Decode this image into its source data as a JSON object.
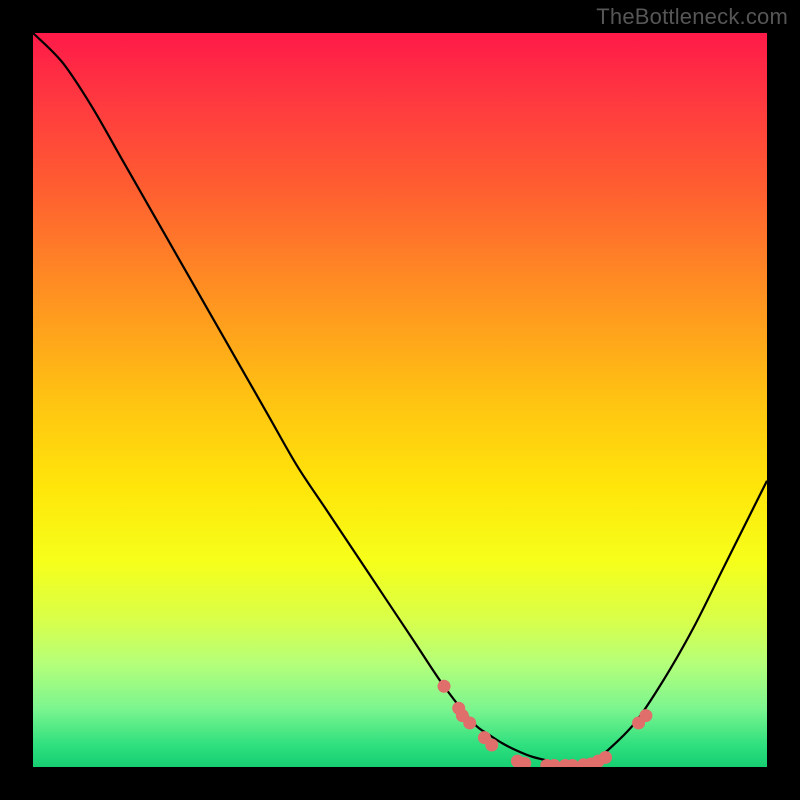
{
  "watermark": "TheBottleneck.com",
  "chart_data": {
    "type": "line",
    "title": "",
    "xlabel": "",
    "ylabel": "",
    "xlim": [
      0,
      100
    ],
    "ylim": [
      0,
      100
    ],
    "x": [
      0,
      4,
      8,
      12,
      16,
      20,
      24,
      28,
      32,
      36,
      40,
      44,
      48,
      52,
      56,
      60,
      62,
      64,
      66,
      68,
      70,
      72,
      74,
      76,
      78,
      82,
      86,
      90,
      94,
      98,
      100
    ],
    "values": [
      100,
      96,
      90,
      83,
      76,
      69,
      62,
      55,
      48,
      41,
      35,
      29,
      23,
      17,
      11,
      6,
      4.5,
      3.2,
      2.2,
      1.4,
      0.9,
      0.5,
      0.3,
      0.5,
      2,
      6,
      12,
      19,
      27,
      35,
      39
    ],
    "gradient_stops": [
      {
        "offset": 0.0,
        "color": "#ff1a49"
      },
      {
        "offset": 0.1,
        "color": "#ff3b3f"
      },
      {
        "offset": 0.2,
        "color": "#ff5a32"
      },
      {
        "offset": 0.35,
        "color": "#ff8f22"
      },
      {
        "offset": 0.5,
        "color": "#ffc312"
      },
      {
        "offset": 0.62,
        "color": "#ffe60a"
      },
      {
        "offset": 0.72,
        "color": "#f6ff1a"
      },
      {
        "offset": 0.8,
        "color": "#d8ff4a"
      },
      {
        "offset": 0.86,
        "color": "#b4ff7a"
      },
      {
        "offset": 0.92,
        "color": "#7cf58f"
      },
      {
        "offset": 0.97,
        "color": "#2fe07e"
      },
      {
        "offset": 1.0,
        "color": "#16cf72"
      }
    ],
    "markers": [
      {
        "x": 56,
        "y": 11
      },
      {
        "x": 58,
        "y": 8
      },
      {
        "x": 58.5,
        "y": 7
      },
      {
        "x": 59.5,
        "y": 6
      },
      {
        "x": 61.5,
        "y": 4
      },
      {
        "x": 62.5,
        "y": 3
      },
      {
        "x": 66,
        "y": 0.8
      },
      {
        "x": 67,
        "y": 0.5
      },
      {
        "x": 70,
        "y": 0.2
      },
      {
        "x": 71,
        "y": 0.2
      },
      {
        "x": 72.5,
        "y": 0.2
      },
      {
        "x": 73.5,
        "y": 0.2
      },
      {
        "x": 75,
        "y": 0.3
      },
      {
        "x": 76,
        "y": 0.4
      },
      {
        "x": 77,
        "y": 0.8
      },
      {
        "x": 78,
        "y": 1.3
      },
      {
        "x": 82.5,
        "y": 6
      },
      {
        "x": 83.5,
        "y": 7
      }
    ],
    "marker_color": "#e06f6c",
    "curve_color": "#000000"
  }
}
